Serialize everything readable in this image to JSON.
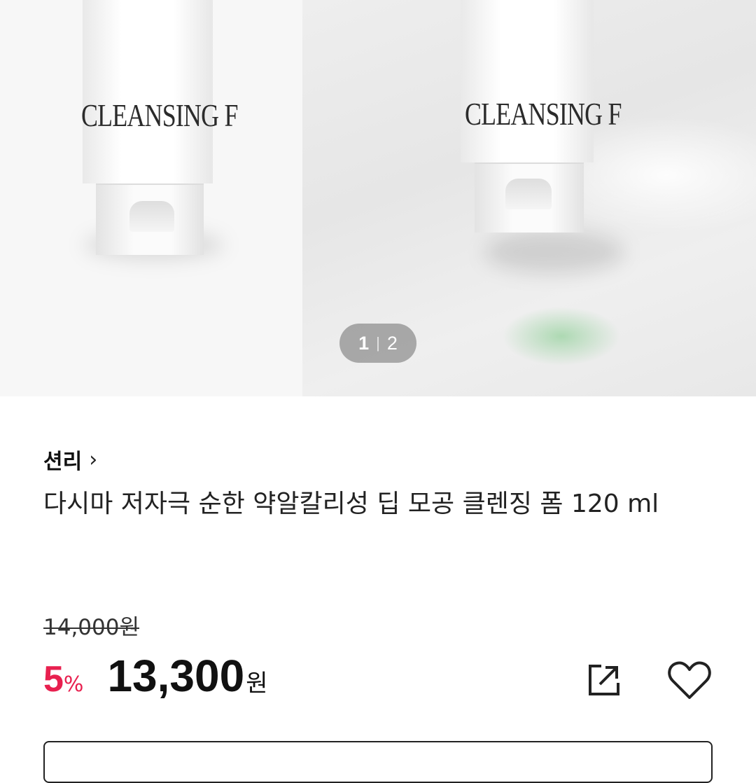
{
  "gallery": {
    "left_image": {
      "alt": "product-tube-white",
      "label_text": "CLEANSING F"
    },
    "right_image": {
      "alt": "product-tube-on-foam",
      "label_text": "CLEANSING F"
    },
    "counter": {
      "current": "1",
      "separator": "|",
      "total": "2"
    }
  },
  "product": {
    "brand": "션리",
    "brand_chevron": "›",
    "title": "다시마 저자극 순한 약알칼리성 딥 모공 클렌징 폼 120 ml",
    "original_price": "14,000원",
    "discount_value": "5",
    "discount_unit": "%",
    "sale_price": "13,300",
    "currency": "원"
  },
  "actions": {
    "share_icon": "share-icon",
    "like_icon": "heart-icon"
  },
  "colors": {
    "discount": "#e8204f",
    "text": "#222222"
  }
}
